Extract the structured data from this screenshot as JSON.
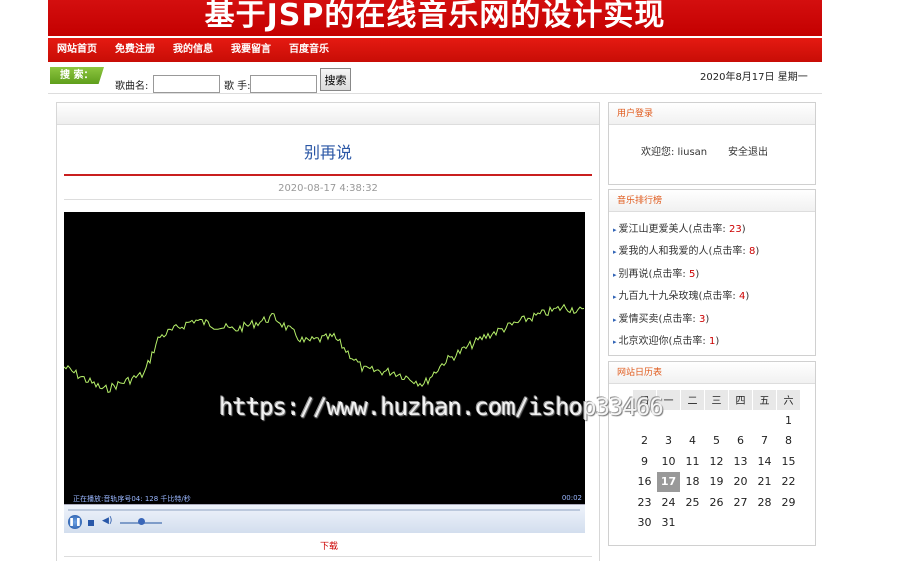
{
  "banner": {
    "title": "基于JSP的在线音乐网的设计实现"
  },
  "nav": [
    "网站首页",
    "免费注册",
    "我的信息",
    "我要留言",
    "百度音乐"
  ],
  "search": {
    "tag": "搜 索：",
    "song_label": "歌曲名:",
    "singer_label": "歌 手:",
    "song_value": "",
    "singer_value": "",
    "button": "搜索"
  },
  "date_text": "2020年8月17日 星期一",
  "song": {
    "title": "别再说",
    "published": "2020-08-17 4:38:32",
    "player_status": "正在播放:音轨序号04: 128 千比特/秒",
    "player_time": "00:02",
    "download": "下载"
  },
  "login": {
    "title": "用户登录",
    "welcome": "欢迎您: liusan",
    "logout": "安全退出"
  },
  "ranking": {
    "title": "音乐排行榜",
    "prefix": "(点击率: ",
    "suffix": ")",
    "items": [
      {
        "name": "爱江山更爱美人",
        "count": "23"
      },
      {
        "name": "爱我的人和我爱的人",
        "count": "8"
      },
      {
        "name": "别再说",
        "count": "5"
      },
      {
        "name": "九百九十九朵玫瑰",
        "count": "4"
      },
      {
        "name": "爱情买卖",
        "count": "3"
      },
      {
        "name": "北京欢迎你",
        "count": "1"
      }
    ]
  },
  "calendar": {
    "title": "网站日历表",
    "weekdays": [
      "日",
      "一",
      "二",
      "三",
      "四",
      "五",
      "六"
    ],
    "weeks": [
      [
        "",
        "",
        "",
        "",
        "",
        "",
        "1"
      ],
      [
        "2",
        "3",
        "4",
        "5",
        "6",
        "7",
        "8"
      ],
      [
        "9",
        "10",
        "11",
        "12",
        "13",
        "14",
        "15"
      ],
      [
        "16",
        "17",
        "18",
        "19",
        "20",
        "21",
        "22"
      ],
      [
        "23",
        "24",
        "25",
        "26",
        "27",
        "28",
        "29"
      ],
      [
        "30",
        "31",
        "",
        "",
        "",
        "",
        ""
      ]
    ],
    "today": "17"
  },
  "watermark": "https://www.huzhan.com/ishop33466",
  "colors": {
    "brand_red": "#c40000",
    "wave": "#b6f06a",
    "accent_orange": "#e05a1c"
  }
}
